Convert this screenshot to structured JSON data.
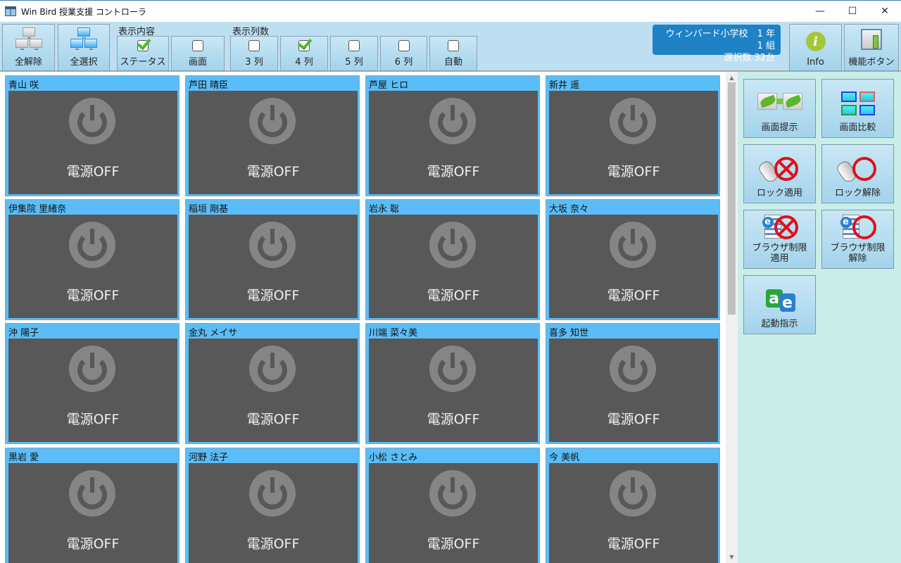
{
  "window": {
    "title": "Win Bird 授業支援 コントローラ",
    "controls": {
      "minimize": "—",
      "maximize": "☐",
      "close": "✕"
    }
  },
  "toolbar": {
    "deselect_all": "全解除",
    "select_all": "全選択",
    "display_content_label": "表示内容",
    "display_content_options": [
      {
        "label": "ステータス",
        "checked": true
      },
      {
        "label": "画面",
        "checked": false
      }
    ],
    "columns_label": "表示列数",
    "column_options": [
      {
        "label": "3 列",
        "checked": false
      },
      {
        "label": "4 列",
        "checked": true
      },
      {
        "label": "5 列",
        "checked": false
      },
      {
        "label": "6 列",
        "checked": false
      },
      {
        "label": "自動",
        "checked": false
      }
    ],
    "class_info": {
      "school_class": "ウィンバード小学校　1 年 1 組",
      "selected_count": "選択数 32台"
    },
    "info_button": "Info",
    "function_button": "機能ボタン"
  },
  "students": [
    {
      "name": "青山 咲",
      "status": "電源OFF"
    },
    {
      "name": "芦田 晴臣",
      "status": "電源OFF"
    },
    {
      "name": "芦屋 ヒロ",
      "status": "電源OFF"
    },
    {
      "name": "新井 遥",
      "status": "電源OFF"
    },
    {
      "name": "伊集院 里緒奈",
      "status": "電源OFF"
    },
    {
      "name": "稲垣 剛基",
      "status": "電源OFF"
    },
    {
      "name": "岩永 聡",
      "status": "電源OFF"
    },
    {
      "name": "大坂 奈々",
      "status": "電源OFF"
    },
    {
      "name": "沖 陽子",
      "status": "電源OFF"
    },
    {
      "name": "金丸 メイサ",
      "status": "電源OFF"
    },
    {
      "name": "川端 菜々美",
      "status": "電源OFF"
    },
    {
      "name": "喜多 知世",
      "status": "電源OFF"
    },
    {
      "name": "黒岩 愛",
      "status": "電源OFF"
    },
    {
      "name": "河野 法子",
      "status": "電源OFF"
    },
    {
      "name": "小松 さとみ",
      "status": "電源OFF"
    },
    {
      "name": "今 美帆",
      "status": "電源OFF"
    }
  ],
  "side_panel": {
    "screen_present": "画面提示",
    "screen_compare": "画面比較",
    "lock_apply": "ロック適用",
    "lock_release": "ロック解除",
    "browser_restrict_apply_line1": "ブラウザ制限",
    "browser_restrict_apply_line2": "適用",
    "browser_restrict_release_line1": "ブラウザ制限",
    "browser_restrict_release_line2": "解除",
    "launch_instruction": "起動指示"
  },
  "scrollbar": {
    "up": "▲",
    "down": "▼"
  },
  "colors": {
    "tile_header": "#5bbdf7",
    "tile_screen": "#585858",
    "class_badge": "#1e82c5",
    "toolbar_bg": "#bedff1",
    "side_panel_bg": "#c9ede8"
  }
}
